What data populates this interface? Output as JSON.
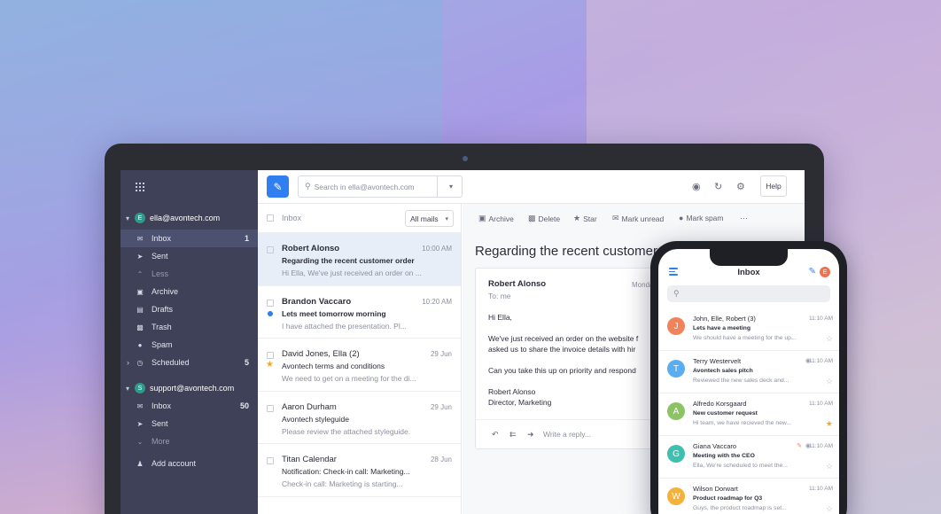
{
  "sidebar": {
    "accounts": [
      {
        "initial": "E",
        "email": "ella@avontech.com"
      },
      {
        "initial": "S",
        "email": "support@avontech.com"
      }
    ],
    "ella_items": [
      {
        "label": "Inbox",
        "count": "1"
      },
      {
        "label": "Sent",
        "count": ""
      },
      {
        "label": "Less",
        "count": ""
      },
      {
        "label": "Archive",
        "count": ""
      },
      {
        "label": "Drafts",
        "count": ""
      },
      {
        "label": "Trash",
        "count": ""
      },
      {
        "label": "Spam",
        "count": ""
      },
      {
        "label": "Scheduled",
        "count": "5"
      }
    ],
    "support_items": [
      {
        "label": "Inbox",
        "count": "50"
      },
      {
        "label": "Sent",
        "count": ""
      },
      {
        "label": "More",
        "count": ""
      }
    ],
    "add_account": "Add account"
  },
  "topbar": {
    "search_placeholder": "Search in ella@avontech.com",
    "help": "Help"
  },
  "list": {
    "folder": "Inbox",
    "filter": "All mails",
    "mails": [
      {
        "from": "Robert Alonso",
        "time": "10:00 AM",
        "subject": "Regarding the recent customer order",
        "preview": "Hi Ella, We've just received an order on ..."
      },
      {
        "from": "Brandon Vaccaro",
        "time": "10:20 AM",
        "subject": "Lets meet tomorrow morning",
        "preview": "I have attached the presentation. Pl..."
      },
      {
        "from": "David Jones, Ella (2)",
        "time": "29 Jun",
        "subject": "Avontech terms and conditions",
        "preview": "We need to get on a meeting for the di..."
      },
      {
        "from": "Aaron Durham",
        "time": "29 Jun",
        "subject": "Avontech styleguide",
        "preview": "Please review the attached styleguide."
      },
      {
        "from": "Titan Calendar",
        "time": "28 Jun",
        "subject": "Notification: Check-in call: Marketing...",
        "preview": "Check-in call: Marketing is starting..."
      }
    ]
  },
  "reader": {
    "actions": [
      "Archive",
      "Delete",
      "Star",
      "Mark unread",
      "Mark spam"
    ],
    "title": "Regarding the recent customer order",
    "from": "Robert Alonso",
    "date": "Monday",
    "to": "To: me",
    "greeting": "Hi Ella,",
    "line1": "We've just received an order on the website f",
    "line2": "asked us to share the invoice details with hir",
    "line3": "Can you take this up on priority and respond",
    "sig1": "Robert Alonso",
    "sig2": "Director, Marketing",
    "reply_placeholder": "Write a reply..."
  },
  "phone": {
    "title": "Inbox",
    "avatar": "E",
    "items": [
      {
        "initial": "J",
        "color": "#f0835a",
        "from": "John, Elle, Robert (3)",
        "time": "11:10 AM",
        "subject": "Lets have a meeting",
        "preview": "We should have a meeting for the up...",
        "starred": false
      },
      {
        "initial": "T",
        "color": "#5aaef0",
        "from": "Terry Westervelt",
        "time": "11:10 AM",
        "subject": "Avontech sales pitch",
        "preview": "Reviewed the new sales deck and...",
        "starred": false
      },
      {
        "initial": "A",
        "color": "#8cc465",
        "from": "Alfredo Korsgaard",
        "time": "11:10 AM",
        "subject": "New customer request",
        "preview": "Hi team, we have recieved the new...",
        "starred": true
      },
      {
        "initial": "G",
        "color": "#3fbfae",
        "from": "Giana Vaccaro",
        "time": "11:10 AM",
        "subject": "Meeting with the CEO",
        "preview": "Ella, We're scheduled to meet the...",
        "starred": false
      },
      {
        "initial": "W",
        "color": "#f5b23a",
        "from": "Wilson Dorwart",
        "time": "11:10 AM",
        "subject": "Product roadmap for Q3",
        "preview": "Guys, the product roadmap is set...",
        "starred": false
      }
    ]
  }
}
